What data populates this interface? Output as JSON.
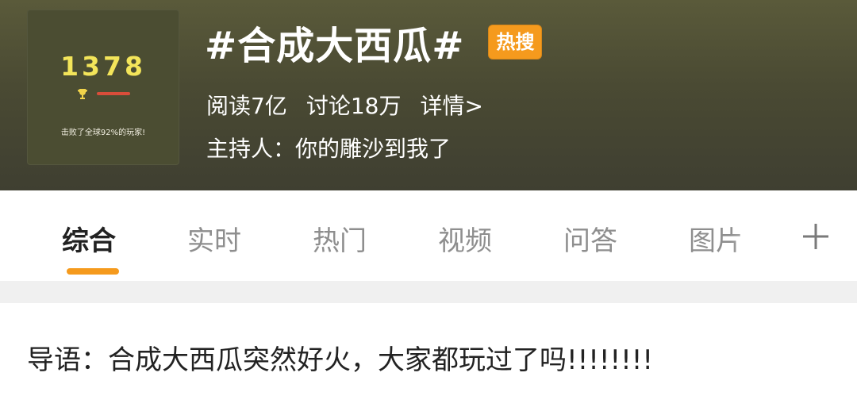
{
  "topic": {
    "thumbnail": {
      "score": "1378",
      "caption": "击败了全球92%的玩家!"
    },
    "title": "#合成大西瓜#",
    "badge": "热搜",
    "reads": "阅读7亿",
    "discussions": "讨论18万",
    "details_link": "详情>",
    "host": "主持人：你的雕沙到我了"
  },
  "tabs": [
    {
      "label": "综合",
      "active": true
    },
    {
      "label": "实时",
      "active": false
    },
    {
      "label": "热门",
      "active": false
    },
    {
      "label": "视频",
      "active": false
    },
    {
      "label": "问答",
      "active": false
    },
    {
      "label": "图片",
      "active": false
    }
  ],
  "tabs_more_icon": "plus-icon",
  "lead": {
    "text": "导语：合成大西瓜突然好火，大家都玩过了吗!!!!!!!!"
  },
  "colors": {
    "accent": "#f59a1d",
    "header_bg": "#4a4a33",
    "tab_active": "#222222",
    "tab_inactive": "#8e8e8e"
  }
}
